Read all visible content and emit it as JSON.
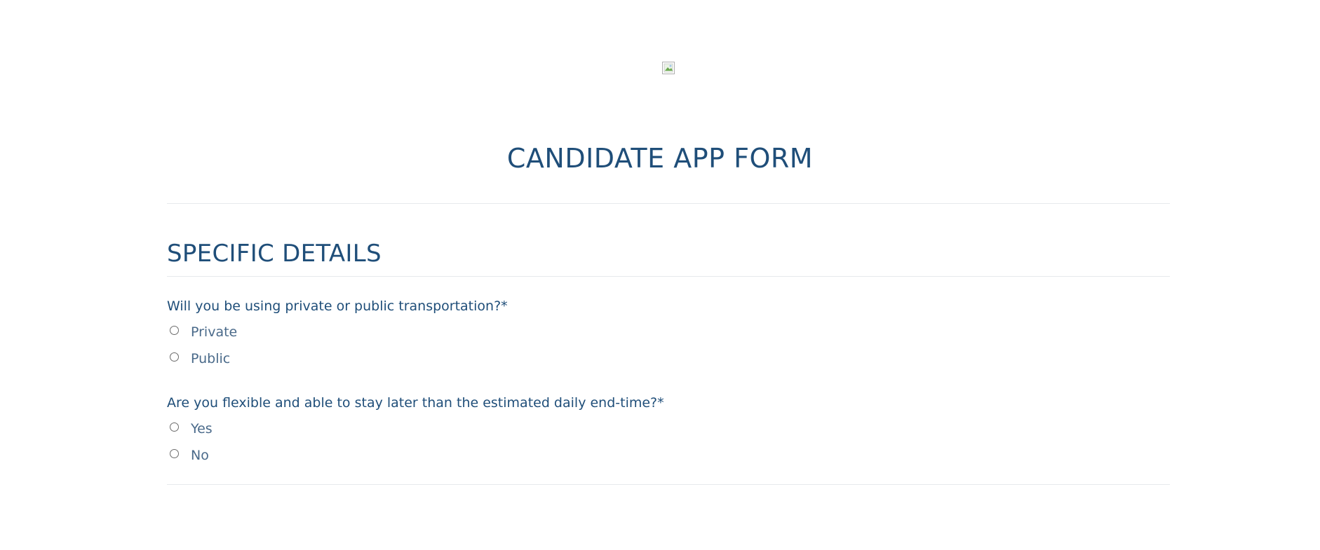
{
  "logo": {
    "icon": "broken-image-icon"
  },
  "form": {
    "title": "CANDIDATE APP FORM"
  },
  "section": {
    "title": "SPECIFIC DETAILS"
  },
  "questions": [
    {
      "label": "Will you be using private or public transportation?*",
      "options": [
        "Private",
        "Public"
      ]
    },
    {
      "label": "Are you flexible and able to stay later than the estimated daily end-time?*",
      "options": [
        "Yes",
        "No"
      ]
    }
  ],
  "colors": {
    "primary": "#1f4e79",
    "option_text": "#4a6a8a",
    "divider": "#e6e9ec"
  }
}
